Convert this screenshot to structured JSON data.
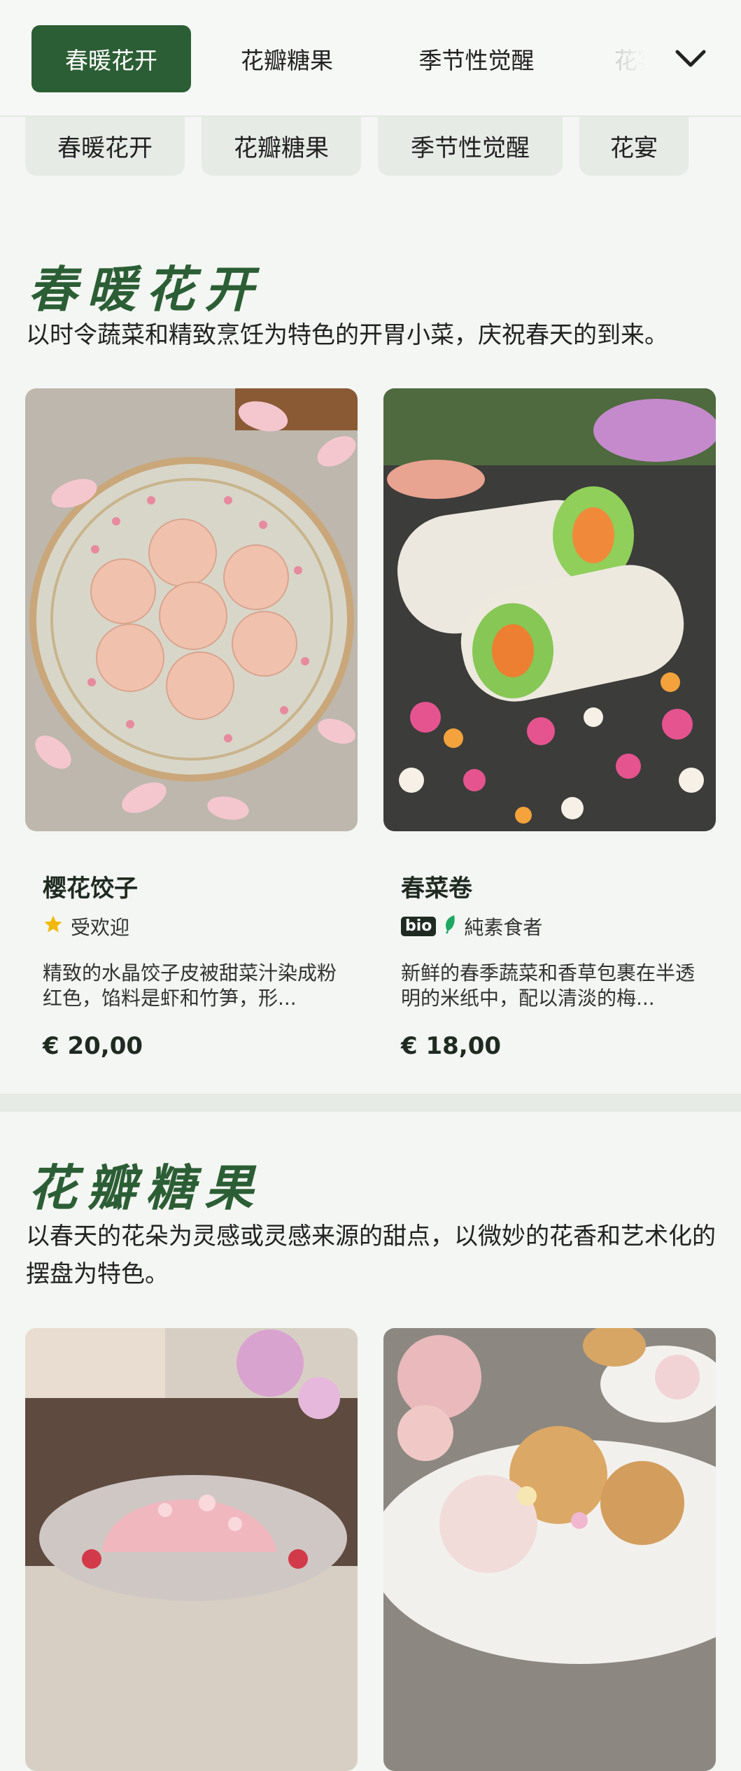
{
  "top_tabs": [
    {
      "label": "春暖花开",
      "active": true
    },
    {
      "label": "花瓣糖果",
      "active": false
    },
    {
      "label": "季节性觉醒",
      "active": false
    },
    {
      "label": "花宴",
      "active": false
    }
  ],
  "chips": [
    "春暖花开",
    "花瓣糖果",
    "季节性觉醒",
    "花宴"
  ],
  "colors": {
    "accent": "#2c5e35",
    "background": "#f3f6f2",
    "star": "#f2b807",
    "leaf": "#1ea860"
  },
  "sections": [
    {
      "title": "春暖花开",
      "description": "以时令蔬菜和精致烹饪为特色的开胃小菜，庆祝春天的到来。",
      "items": [
        {
          "name": "樱花饺子",
          "tag_icon": "star-icon",
          "tag": "受欢迎",
          "description": "精致的水晶饺子皮被甜菜汁染成粉红色，馅料是虾和竹笋，形...",
          "price": "€ 20,00"
        },
        {
          "name": "春菜卷",
          "tag_badge": "bio",
          "tag_icon": "leaf-icon",
          "tag": "純素食者",
          "description": "新鲜的春季蔬菜和香草包裹在半透明的米纸中，配以清淡的梅...",
          "price": "€ 18,00"
        }
      ]
    },
    {
      "title": "花瓣糖果",
      "description": "以春天的花朵为灵感或灵感来源的甜点，以微妙的花香和艺术化的摆盘为特色。",
      "items": [
        {
          "image": "rose-petal-jelly-photo"
        },
        {
          "image": "floral-ice-cream-photo"
        }
      ]
    }
  ]
}
